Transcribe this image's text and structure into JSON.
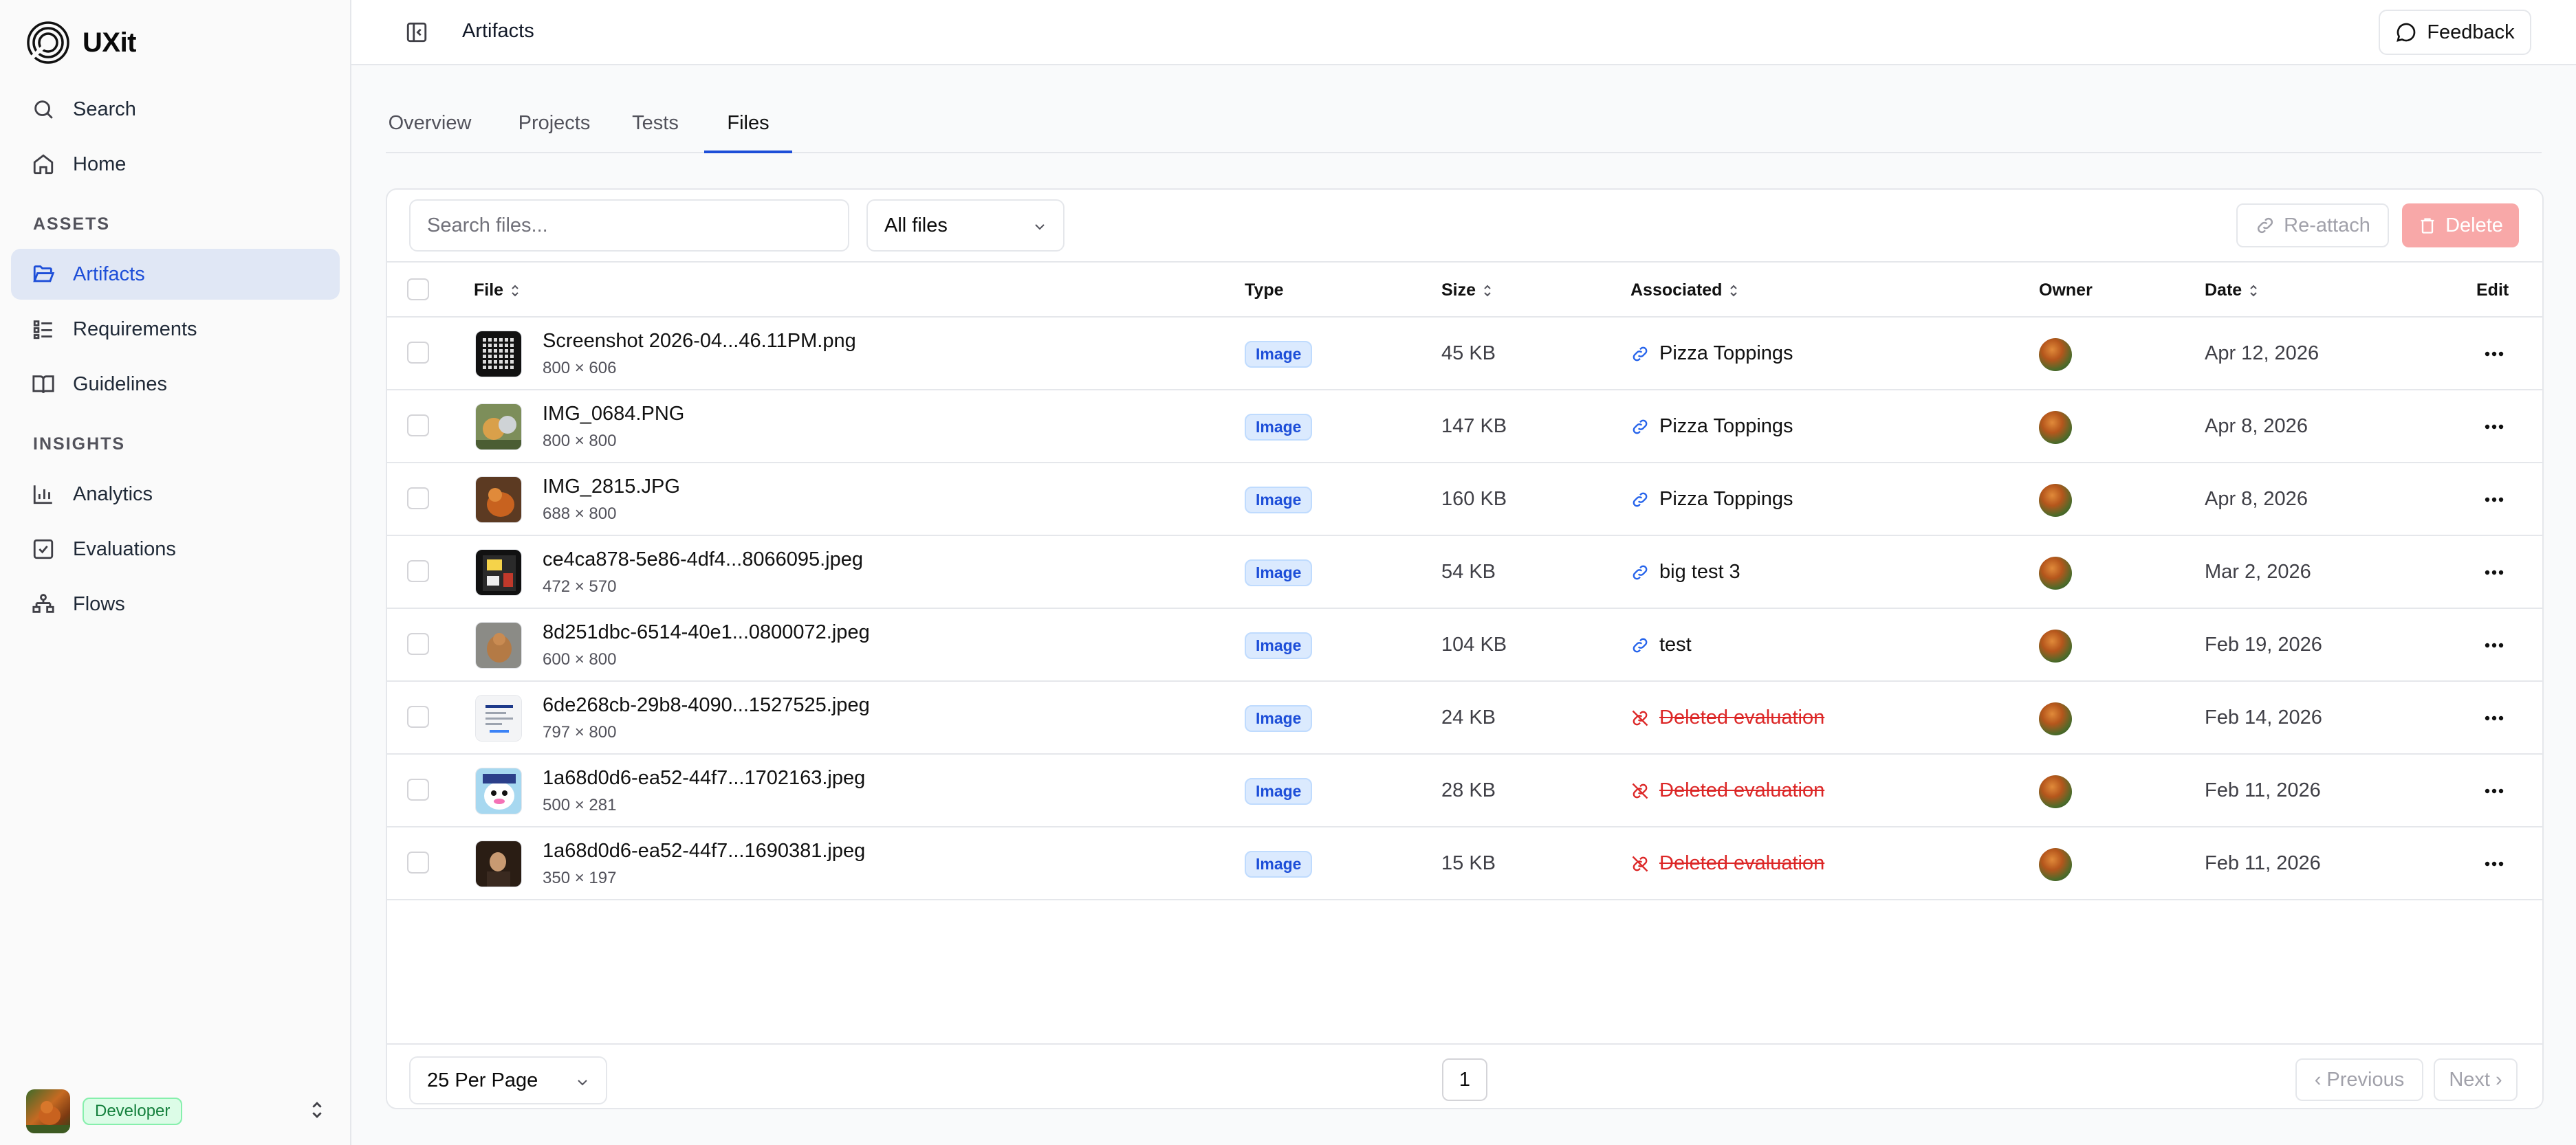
{
  "app": {
    "name": "UXit"
  },
  "sidebar": {
    "items_top": [
      {
        "label": "Search",
        "icon": "search-icon"
      },
      {
        "label": "Home",
        "icon": "home-icon"
      }
    ],
    "section_assets": "ASSETS",
    "items_assets": [
      {
        "label": "Artifacts",
        "icon": "folder-open-icon",
        "active": true
      },
      {
        "label": "Requirements",
        "icon": "list-icon"
      },
      {
        "label": "Guidelines",
        "icon": "book-icon"
      }
    ],
    "section_insights": "INSIGHTS",
    "items_insights": [
      {
        "label": "Analytics",
        "icon": "bar-chart-icon"
      },
      {
        "label": "Evaluations",
        "icon": "checkbox-icon"
      },
      {
        "label": "Flows",
        "icon": "workflow-icon"
      }
    ],
    "user": {
      "role": "Developer"
    }
  },
  "header": {
    "breadcrumb": "Artifacts",
    "feedback_label": "Feedback"
  },
  "tabs": [
    "Overview",
    "Projects",
    "Tests",
    "Files"
  ],
  "active_tab": "Files",
  "toolbar": {
    "search_placeholder": "Search files...",
    "filter_value": "All files",
    "reattach_label": "Re-attach",
    "delete_label": "Delete"
  },
  "table": {
    "columns": {
      "file": "File",
      "type": "Type",
      "size": "Size",
      "associated": "Associated",
      "owner": "Owner",
      "date": "Date",
      "edit": "Edit"
    },
    "rows": [
      {
        "name": "Screenshot 2026-04...46.11PM.png",
        "dims": "800 × 606",
        "type": "Image",
        "size": "45 KB",
        "associated": "Pizza Toppings",
        "deleted": false,
        "date": "Apr 12, 2026"
      },
      {
        "name": "IMG_0684.PNG",
        "dims": "800 × 800",
        "type": "Image",
        "size": "147 KB",
        "associated": "Pizza Toppings",
        "deleted": false,
        "date": "Apr 8, 2026"
      },
      {
        "name": "IMG_2815.JPG",
        "dims": "688 × 800",
        "type": "Image",
        "size": "160 KB",
        "associated": "Pizza Toppings",
        "deleted": false,
        "date": "Apr 8, 2026"
      },
      {
        "name": "ce4ca878-5e86-4df4...8066095.jpeg",
        "dims": "472 × 570",
        "type": "Image",
        "size": "54 KB",
        "associated": "big test 3",
        "deleted": false,
        "date": "Mar 2, 2026"
      },
      {
        "name": "8d251dbc-6514-40e1...0800072.jpeg",
        "dims": "600 × 800",
        "type": "Image",
        "size": "104 KB",
        "associated": "test",
        "deleted": false,
        "date": "Feb 19, 2026"
      },
      {
        "name": "6de268cb-29b8-4090...1527525.jpeg",
        "dims": "797 × 800",
        "type": "Image",
        "size": "24 KB",
        "associated": "Deleted evaluation",
        "deleted": true,
        "date": "Feb 14, 2026"
      },
      {
        "name": "1a68d0d6-ea52-44f7...1702163.jpeg",
        "dims": "500 × 281",
        "type": "Image",
        "size": "28 KB",
        "associated": "Deleted evaluation",
        "deleted": true,
        "date": "Feb 11, 2026"
      },
      {
        "name": "1a68d0d6-ea52-44f7...1690381.jpeg",
        "dims": "350 × 197",
        "type": "Image",
        "size": "15 KB",
        "associated": "Deleted evaluation",
        "deleted": true,
        "date": "Feb 11, 2026"
      }
    ]
  },
  "pagination": {
    "per_page": "25 Per Page",
    "page": "1",
    "previous": "‹ Previous",
    "next": "Next ›"
  },
  "colors": {
    "accent": "#1d4ed8",
    "active_bg": "#e0e7f5",
    "danger": "#dc2626",
    "delete_btn": "#f8a8a8",
    "badge_bg": "#dbeafe"
  }
}
